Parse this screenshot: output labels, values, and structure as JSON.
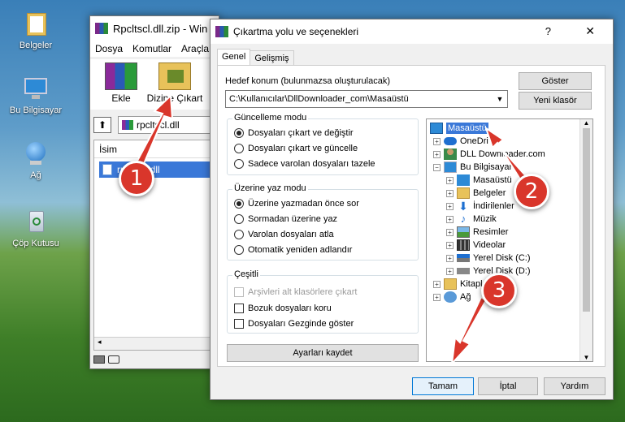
{
  "desktop": {
    "icons": [
      {
        "label": "Belgeler",
        "icon": "folder-icon"
      },
      {
        "label": "Bu Bilgisayar",
        "icon": "computer-icon"
      },
      {
        "label": "Ağ",
        "icon": "network-icon"
      },
      {
        "label": "Çöp Kutusu",
        "icon": "recycle-bin-icon"
      }
    ]
  },
  "winrar": {
    "title": "Rpcltscl.dll.zip - Win",
    "menu": [
      "Dosya",
      "Komutlar",
      "Araçla"
    ],
    "toolbar": {
      "extract": "Ekle",
      "extract_to": "Dizine Çıkart"
    },
    "path": "rpcltscl.dll",
    "column_name": "İsim",
    "file": "rpcltscl.dll"
  },
  "dialog": {
    "title": "Çıkartma yolu ve seçenekleri",
    "help": "?",
    "close": "✕",
    "tabs": [
      "Genel",
      "Gelişmiş"
    ],
    "dest_label": "Hedef konum (bulunmazsa oluşturulacak)",
    "dest_value": "C:\\Kullanıcılar\\DllDownloader_com\\Masaüstü",
    "btn_show": "Göster",
    "btn_new_folder": "Yeni klasör",
    "update_mode": {
      "title": "Güncelleme modu",
      "options": [
        "Dosyaları çıkart ve değiştir",
        "Dosyaları çıkart ve güncelle",
        "Sadece varolan dosyaları tazele"
      ]
    },
    "overwrite_mode": {
      "title": "Üzerine yaz modu",
      "options": [
        "Üzerine yazmadan önce sor",
        "Sormadan üzerine yaz",
        "Varolan dosyaları atla",
        "Otomatik yeniden adlandır"
      ]
    },
    "misc": {
      "title": "Çeşitli",
      "options": [
        "Arşivleri alt klasörlere çıkart",
        "Bozuk dosyaları koru",
        "Dosyaları Gezginde göster"
      ]
    },
    "btn_save": "Ayarları kaydet",
    "tree": [
      "Masaüstü",
      "OneDri",
      "DLL Downloader.com",
      "Bu Bilgisayar",
      "Masaüstü",
      "Belgeler",
      "İndirilenler",
      "Müzik",
      "Resimler",
      "Videolar",
      "Yerel Disk (C:)",
      "Yerel Disk (D:)",
      "Kitapl",
      "Ağ"
    ],
    "btn_ok": "Tamam",
    "btn_cancel": "İptal",
    "btn_help": "Yardım"
  },
  "callouts": [
    "1",
    "2",
    "3"
  ]
}
